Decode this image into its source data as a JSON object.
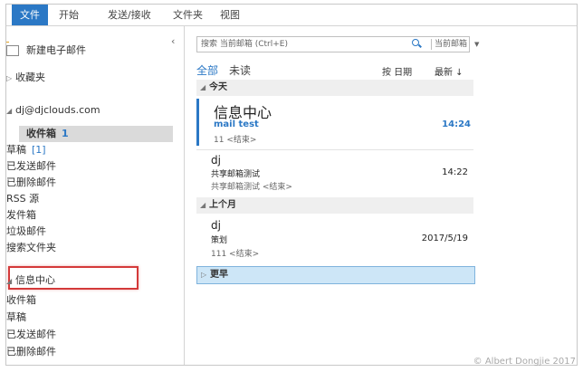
{
  "ribbon": {
    "tabs": [
      "文件",
      "开始",
      "发送/接收",
      "文件夹",
      "视图"
    ]
  },
  "nav": {
    "new_mail": "新建电子邮件",
    "collapse": "‹",
    "favorites": "收藏夹",
    "account": "dj@djclouds.com",
    "folders": [
      {
        "name": "收件箱",
        "count": "1"
      },
      {
        "name": "草稿",
        "count": "[1]"
      },
      {
        "name": "已发送邮件"
      },
      {
        "name": "已删除邮件"
      },
      {
        "name": "RSS 源"
      },
      {
        "name": "发件箱"
      },
      {
        "name": "垃圾邮件"
      },
      {
        "name": "搜索文件夹"
      }
    ],
    "group2": "信息中心",
    "group2_folders": [
      "收件箱",
      "草稿",
      "已发送邮件",
      "已删除邮件"
    ]
  },
  "list": {
    "search_placeholder": "搜索 当前邮箱 (Ctrl+E)",
    "search_scope": "当前邮箱",
    "filter_all": "全部",
    "filter_unread": "未读",
    "sort_by": "按 日期",
    "sort_order": "最新 ↓",
    "groups": {
      "today": "今天",
      "last_month": "上个月",
      "earlier": "更早"
    },
    "messages": [
      {
        "sender": "信息中心",
        "subject": "mail test",
        "time": "14:24",
        "preview": "11 <结束>"
      },
      {
        "sender": "dj",
        "subject": "共享邮箱测试",
        "time": "14:22",
        "preview": "共享邮箱测试 <结束>"
      },
      {
        "sender": "dj",
        "subject": "策划",
        "time": "2017/5/19",
        "preview": "111 <结束>"
      }
    ]
  },
  "copyright": "© Albert Dongjie 2017",
  "colors": {
    "accent": "#2b78c5",
    "highlight_box": "#d43a3a"
  }
}
